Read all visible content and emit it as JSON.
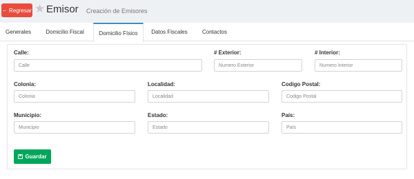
{
  "header": {
    "back_label": "Regresar",
    "back_icon": "arrow-left-icon",
    "favorite_icon": "star-icon",
    "title": "Emisor",
    "subtitle": "Creación de Emisores"
  },
  "tabs": [
    {
      "label": "Generales",
      "active": false
    },
    {
      "label": "Domicilio Fiscal",
      "active": false
    },
    {
      "label": "Domicilio Físico",
      "active": true
    },
    {
      "label": "Datos Fiscales",
      "active": false
    },
    {
      "label": "Contactos",
      "active": false
    }
  ],
  "form": {
    "calle": {
      "label": "Calle:",
      "placeholder": "Calle",
      "value": ""
    },
    "exterior": {
      "label": "# Exterior:",
      "placeholder": "Numero Exterior",
      "value": ""
    },
    "interior": {
      "label": "# Interior:",
      "placeholder": "Numero Interior",
      "value": ""
    },
    "colonia": {
      "label": "Colonia:",
      "placeholder": "Colonia",
      "value": ""
    },
    "localidad": {
      "label": "Localidad:",
      "placeholder": "Localidad",
      "value": ""
    },
    "codigo_postal": {
      "label": "Codigo Postal:",
      "placeholder": "Codigo Postal",
      "value": ""
    },
    "municipio": {
      "label": "Municipio:",
      "placeholder": "Municipio",
      "value": ""
    },
    "estado": {
      "label": "Estado:",
      "placeholder": "Estado",
      "value": ""
    },
    "pais": {
      "label": "País:",
      "placeholder": "País",
      "value": ""
    }
  },
  "actions": {
    "save_label": "Guardar",
    "save_icon": "floppy-disk-icon"
  },
  "colors": {
    "back_button": "#e74c3c",
    "save_button": "#00a65a",
    "active_tab_border": "#3c8dbc",
    "page_background": "#eef1f4"
  }
}
